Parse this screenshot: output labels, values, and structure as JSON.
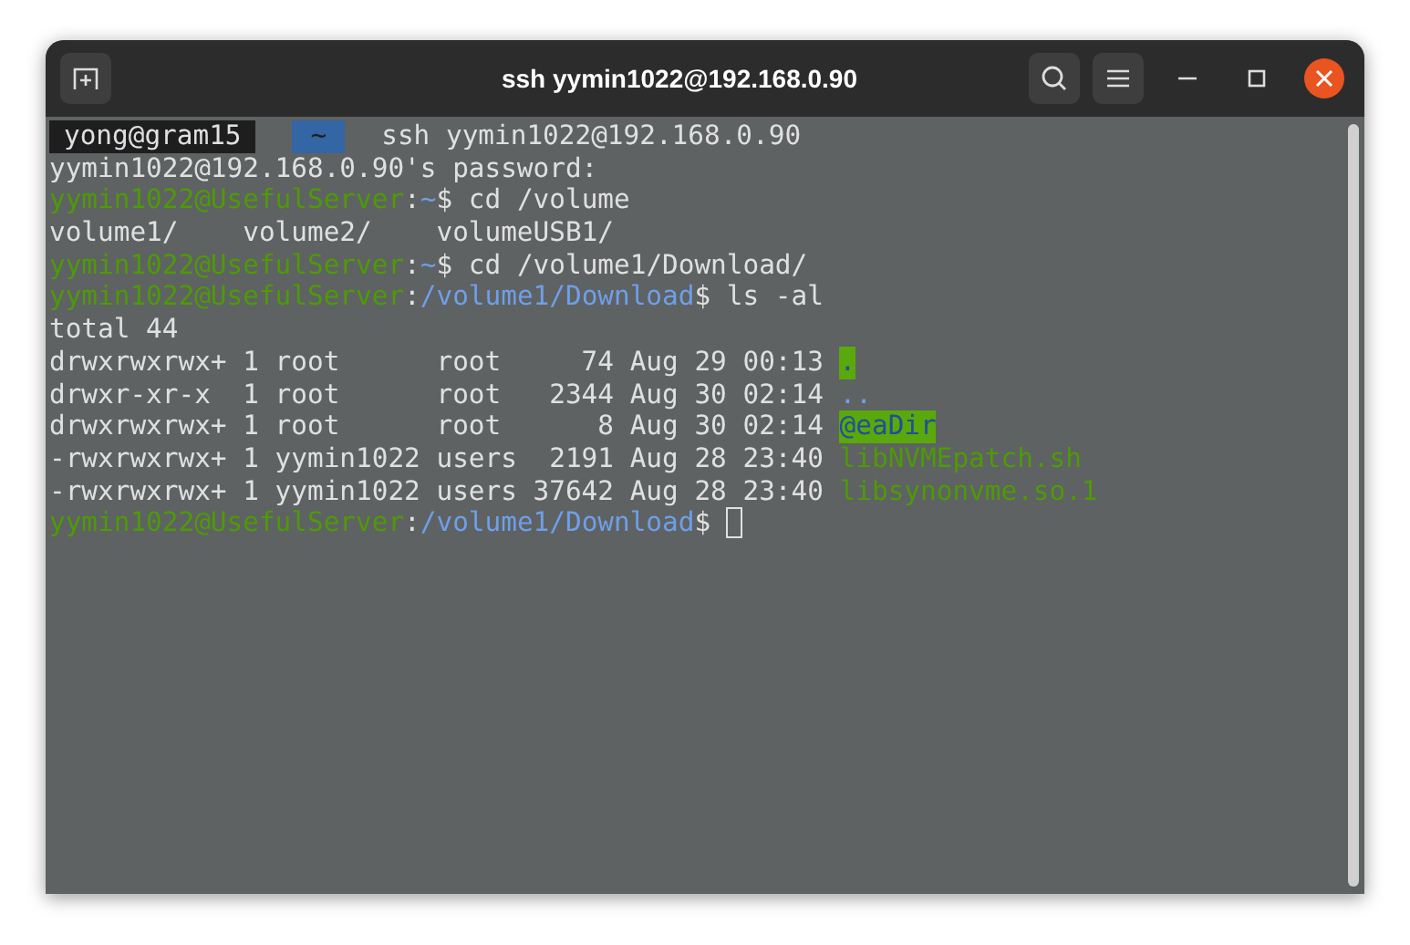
{
  "window": {
    "title": "ssh yymin1022@192.168.0.90"
  },
  "terminal": {
    "cursor_visible": true,
    "lines": [
      {
        "segments": [
          {
            "text": "yong@gram15",
            "kind": "seg-dark"
          },
          {
            "text": "~",
            "kind": "seg-blue"
          },
          {
            "text": "ssh yymin1022@192.168.0.90",
            "kind": "plain"
          }
        ]
      },
      {
        "segments": [
          {
            "text": "yymin1022@192.168.0.90's password:",
            "kind": "plain"
          }
        ]
      },
      {
        "segments": [
          {
            "text": "yymin1022@UsefulServer",
            "kind": "green"
          },
          {
            "text": ":",
            "kind": "plain"
          },
          {
            "text": "~",
            "kind": "blue"
          },
          {
            "text": "$ cd /volume",
            "kind": "plain"
          }
        ]
      },
      {
        "segments": [
          {
            "text": "volume1/    volume2/    volumeUSB1/",
            "kind": "plain"
          }
        ]
      },
      {
        "segments": [
          {
            "text": "yymin1022@UsefulServer",
            "kind": "green"
          },
          {
            "text": ":",
            "kind": "plain"
          },
          {
            "text": "~",
            "kind": "blue"
          },
          {
            "text": "$ cd /volume1/Download/",
            "kind": "plain"
          }
        ]
      },
      {
        "segments": [
          {
            "text": "yymin1022@UsefulServer",
            "kind": "green"
          },
          {
            "text": ":",
            "kind": "plain"
          },
          {
            "text": "/volume1/Download",
            "kind": "blue"
          },
          {
            "text": "$ ls -al",
            "kind": "plain"
          }
        ]
      },
      {
        "segments": [
          {
            "text": "total 44",
            "kind": "plain"
          }
        ]
      },
      {
        "segments": [
          {
            "text": "drwxrwxrwx+ 1 root      root     74 Aug 29 00:13 ",
            "kind": "plain"
          },
          {
            "text": ".",
            "kind": "highlight"
          }
        ]
      },
      {
        "segments": [
          {
            "text": "drwxr-xr-x  1 root      root   2344 Aug 30 02:14 ",
            "kind": "plain"
          },
          {
            "text": "..",
            "kind": "blue"
          }
        ]
      },
      {
        "segments": [
          {
            "text": "drwxrwxrwx+ 1 root      root      8 Aug 30 02:14 ",
            "kind": "plain"
          },
          {
            "text": "@eaDir",
            "kind": "highlight"
          }
        ]
      },
      {
        "segments": [
          {
            "text": "-rwxrwxrwx+ 1 yymin1022 users  2191 Aug 28 23:40 ",
            "kind": "plain"
          },
          {
            "text": "libNVMEpatch.sh",
            "kind": "green"
          }
        ]
      },
      {
        "segments": [
          {
            "text": "-rwxrwxrwx+ 1 yymin1022 users 37642 Aug 28 23:40 ",
            "kind": "plain"
          },
          {
            "text": "libsynonvme.so.1",
            "kind": "green"
          }
        ]
      },
      {
        "segments": [
          {
            "text": "yymin1022@UsefulServer",
            "kind": "green"
          },
          {
            "text": ":",
            "kind": "plain"
          },
          {
            "text": "/volume1/Download",
            "kind": "blue"
          },
          {
            "text": "$ ",
            "kind": "plain"
          }
        ]
      }
    ]
  }
}
